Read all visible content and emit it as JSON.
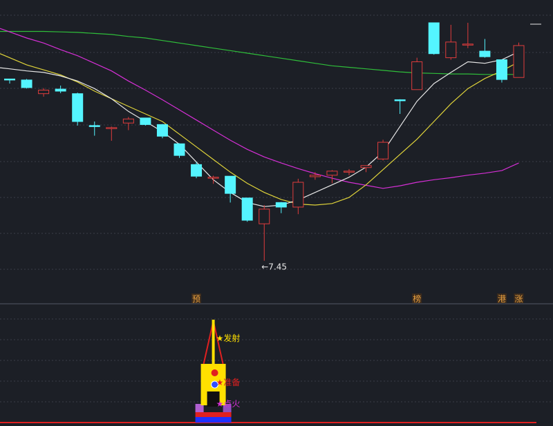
{
  "colors": {
    "background": "#1c1f26",
    "grid": "#3a3e48",
    "up_candle": "#e03c3c",
    "down_candle": "#54f4ff",
    "ma_white": "#e8e8e8",
    "ma_yellow": "#e0d43a",
    "ma_magenta": "#d62fd6",
    "ma_green": "#2fbf3a",
    "signal_red": "#e02020",
    "signal_yellow": "#ffe000",
    "base_blue": "#2030ff",
    "base_purple": "#8a2be2",
    "label_gold": "#e8a040"
  },
  "chart_data": {
    "type": "candlestick",
    "price_range": [
      6.6,
      12.6
    ],
    "low_annotation": "←7.45",
    "candles": [
      {
        "o": 11.04,
        "h": 11.04,
        "l": 10.95,
        "c": 11.04
      },
      {
        "o": 11.02,
        "h": 11.04,
        "l": 10.85,
        "c": 10.87
      },
      {
        "o": 10.75,
        "h": 10.86,
        "l": 10.69,
        "c": 10.82
      },
      {
        "o": 10.84,
        "h": 10.91,
        "l": 10.76,
        "c": 10.8
      },
      {
        "o": 10.75,
        "h": 10.77,
        "l": 10.12,
        "c": 10.2
      },
      {
        "o": 10.12,
        "h": 10.2,
        "l": 9.92,
        "c": 10.1
      },
      {
        "o": 10.06,
        "h": 10.1,
        "l": 9.82,
        "c": 10.08
      },
      {
        "o": 10.17,
        "h": 10.29,
        "l": 10.03,
        "c": 10.25
      },
      {
        "o": 10.27,
        "h": 10.27,
        "l": 10.12,
        "c": 10.14
      },
      {
        "o": 10.14,
        "h": 10.15,
        "l": 9.87,
        "c": 9.91
      },
      {
        "o": 9.76,
        "h": 9.77,
        "l": 9.48,
        "c": 9.53
      },
      {
        "o": 9.35,
        "h": 9.4,
        "l": 9.08,
        "c": 9.12
      },
      {
        "o": 9.08,
        "h": 9.13,
        "l": 8.97,
        "c": 9.1
      },
      {
        "o": 9.12,
        "h": 9.12,
        "l": 8.6,
        "c": 8.78
      },
      {
        "o": 8.69,
        "h": 8.69,
        "l": 8.22,
        "c": 8.25
      },
      {
        "o": 8.18,
        "h": 8.55,
        "l": 7.45,
        "c": 8.47
      },
      {
        "o": 8.6,
        "h": 8.61,
        "l": 8.39,
        "c": 8.51
      },
      {
        "o": 8.51,
        "h": 9.07,
        "l": 8.37,
        "c": 9.0
      },
      {
        "o": 9.11,
        "h": 9.2,
        "l": 9.05,
        "c": 9.14
      },
      {
        "o": 9.14,
        "h": 9.24,
        "l": 8.98,
        "c": 9.22
      },
      {
        "o": 9.2,
        "h": 9.26,
        "l": 9.14,
        "c": 9.22
      },
      {
        "o": 9.29,
        "h": 9.31,
        "l": 9.2,
        "c": 9.33
      },
      {
        "o": 9.46,
        "h": 9.84,
        "l": 9.43,
        "c": 9.79
      },
      {
        "o": 10.63,
        "h": 10.64,
        "l": 10.35,
        "c": 10.63
      },
      {
        "o": 10.83,
        "h": 11.46,
        "l": 10.83,
        "c": 11.38
      },
      {
        "o": 12.15,
        "h": 12.15,
        "l": 11.52,
        "c": 11.54
      },
      {
        "o": 11.46,
        "h": 12.11,
        "l": 11.42,
        "c": 11.77
      },
      {
        "o": 11.71,
        "h": 12.15,
        "l": 11.65,
        "c": 11.73
      },
      {
        "o": 11.59,
        "h": 11.83,
        "l": 11.46,
        "c": 11.48
      },
      {
        "o": 11.42,
        "h": 11.42,
        "l": 10.97,
        "c": 11.03
      },
      {
        "o": 11.07,
        "h": 11.76,
        "l": 11.07,
        "c": 11.7
      }
    ],
    "ma_white": [
      11.24,
      11.2,
      11.17,
      11.1,
      11.0,
      10.85,
      10.65,
      10.4,
      10.2,
      10.0,
      9.75,
      9.4,
      9.05,
      8.8,
      8.6,
      8.52,
      8.55,
      8.65,
      8.8,
      8.95,
      9.1,
      9.3,
      9.6,
      10.1,
      10.6,
      10.95,
      11.17,
      11.38,
      11.35,
      11.42,
      11.58
    ],
    "ma_yellow": [
      11.46,
      11.32,
      11.22,
      11.12,
      10.98,
      10.8,
      10.65,
      10.5,
      10.35,
      10.2,
      9.95,
      9.7,
      9.45,
      9.2,
      8.98,
      8.8,
      8.66,
      8.57,
      8.55,
      8.58,
      8.7,
      8.95,
      9.25,
      9.55,
      9.85,
      10.2,
      10.55,
      10.85,
      11.05,
      11.2,
      11.38
    ],
    "ma_magenta": [
      11.97,
      11.85,
      11.75,
      11.62,
      11.5,
      11.35,
      11.2,
      11.0,
      10.82,
      10.63,
      10.43,
      10.23,
      10.03,
      9.83,
      9.65,
      9.5,
      9.38,
      9.27,
      9.17,
      9.08,
      9.0,
      8.94,
      8.88,
      8.93,
      9.0,
      9.05,
      9.09,
      9.14,
      9.18,
      9.23,
      9.38
    ],
    "ma_green": [
      11.98,
      11.98,
      11.98,
      11.97,
      11.96,
      11.94,
      11.92,
      11.88,
      11.85,
      11.8,
      11.75,
      11.7,
      11.65,
      11.6,
      11.55,
      11.5,
      11.45,
      11.4,
      11.35,
      11.3,
      11.27,
      11.24,
      11.21,
      11.18,
      11.16,
      11.15,
      11.14,
      11.14,
      11.13,
      11.13,
      11.13
    ],
    "markers": [
      {
        "index": 11,
        "label": "预"
      },
      {
        "index": 24,
        "label": "榜"
      },
      {
        "index": 29,
        "label": "港"
      },
      {
        "index": 30,
        "label": "涨"
      }
    ],
    "signal_index": 12,
    "signals": [
      "★发射",
      "★准备",
      "★点火"
    ]
  }
}
